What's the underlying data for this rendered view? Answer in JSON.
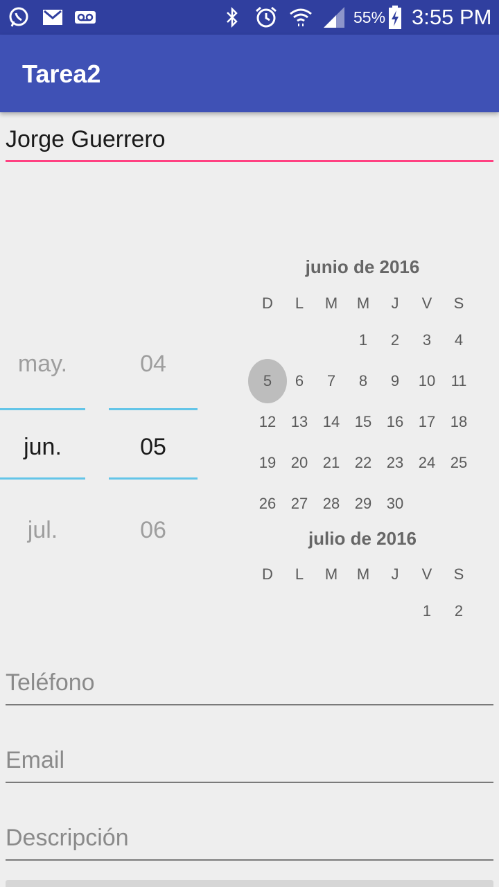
{
  "status_bar": {
    "battery_percent": "55%",
    "time": "3:55 PM",
    "icons": [
      "whatsapp-icon",
      "gmail-icon",
      "voicemail-icon",
      "bluetooth-icon",
      "alarm-icon",
      "wifi-icon",
      "signal-icon",
      "battery-charging-icon"
    ]
  },
  "app_bar": {
    "title": "Tarea2"
  },
  "name_field": {
    "value": "Jorge Guerrero"
  },
  "date_spinner": {
    "month": {
      "prev": "may.",
      "current": "jun.",
      "next": "jul."
    },
    "day": {
      "prev": "04",
      "current": "05",
      "next": "06"
    }
  },
  "calendar": {
    "weekday_headers": [
      "D",
      "L",
      "M",
      "M",
      "J",
      "V",
      "S"
    ],
    "months": [
      {
        "title": "junio de 2016",
        "weeks": [
          [
            "",
            "",
            "",
            "1",
            "2",
            "3",
            "4"
          ],
          [
            "5",
            "6",
            "7",
            "8",
            "9",
            "10",
            "11"
          ],
          [
            "12",
            "13",
            "14",
            "15",
            "16",
            "17",
            "18"
          ],
          [
            "19",
            "20",
            "21",
            "22",
            "23",
            "24",
            "25"
          ],
          [
            "26",
            "27",
            "28",
            "29",
            "30",
            "",
            ""
          ]
        ],
        "selected_day": "5"
      },
      {
        "title": "julio de 2016",
        "weeks": [
          [
            "",
            "",
            "",
            "",
            "",
            "1",
            "2"
          ]
        ]
      }
    ]
  },
  "form": {
    "phone_placeholder": "Teléfono",
    "email_placeholder": "Email",
    "description_placeholder": "Descripción"
  },
  "colors": {
    "status_bar": "#303f9f",
    "app_bar": "#3f51b5",
    "accent": "#ff4081",
    "spinner_divider": "#63c5e8"
  }
}
